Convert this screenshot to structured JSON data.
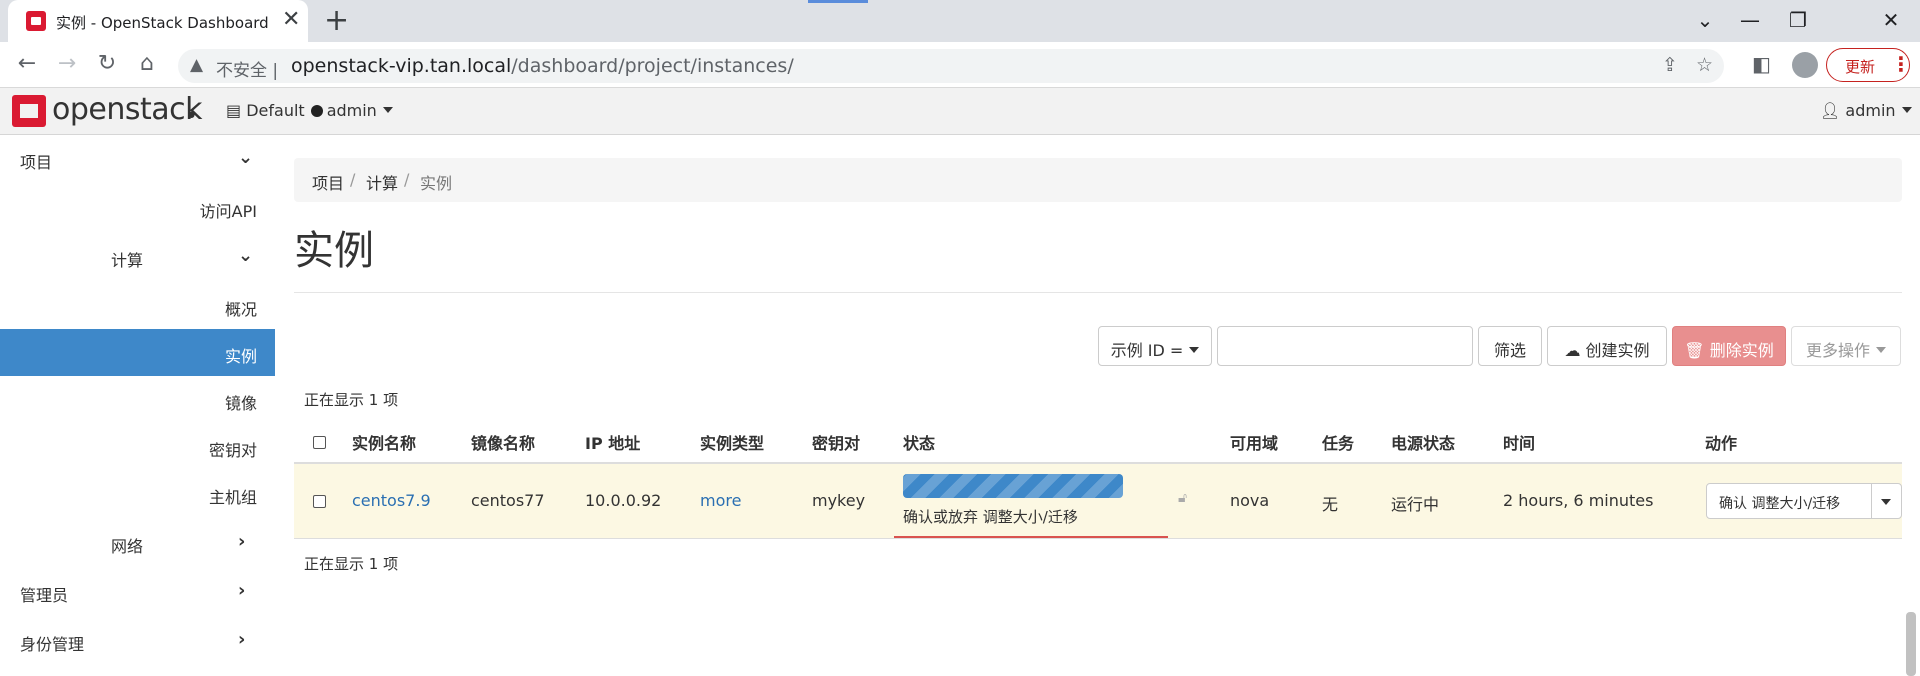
{
  "browser": {
    "tab_title": "实例 - OpenStack Dashboard",
    "tab_close": "✕",
    "new_tab": "+",
    "insecure_label": "不安全",
    "url_host": "openstack-vip.tan.local",
    "url_path": "/dashboard/project/instances/",
    "update_label": "更新",
    "icons": [
      "back-icon",
      "forward-icon",
      "reload-icon",
      "home-icon",
      "warning-icon",
      "share-icon",
      "star-icon",
      "sidepanel-icon",
      "profile-icon",
      "menu-dots-icon"
    ]
  },
  "header": {
    "logo_text": "openstack",
    "domain": "Default",
    "project": "admin",
    "user": "admin"
  },
  "sidebar": {
    "items": [
      {
        "label": "项目",
        "chevron": "down"
      },
      {
        "label": "访问API"
      },
      {
        "label": "计算",
        "chevron": "down"
      },
      {
        "label": "概况"
      },
      {
        "label": "实例",
        "active": true
      },
      {
        "label": "镜像"
      },
      {
        "label": "密钥对"
      },
      {
        "label": "主机组"
      },
      {
        "label": "网络",
        "chevron": "right"
      },
      {
        "label": "管理员",
        "chevron": "right"
      },
      {
        "label": "身份管理",
        "chevron": "right"
      }
    ]
  },
  "breadcrumb": [
    "项目",
    "计算",
    "实例"
  ],
  "page_title": "实例",
  "actions": {
    "filter_field": "示例 ID =",
    "filter_button": "筛选",
    "create_button": "创建实例",
    "delete_button": "删除实例",
    "more_button": "更多操作"
  },
  "showing_count": "正在显示 1 项",
  "table": {
    "headers": [
      "实例名称",
      "镜像名称",
      "IP 地址",
      "实例类型",
      "密钥对",
      "状态",
      "可用域",
      "任务",
      "电源状态",
      "时间",
      "动作"
    ],
    "rows": [
      {
        "name": "centos7.9",
        "image": "centos77",
        "ip": "10.0.0.92",
        "flavor": "more",
        "keypair": "mykey",
        "status": "确认或放弃 调整大小/迁移",
        "zone": "nova",
        "task": "无",
        "power": "运行中",
        "time": "2 hours, 6 minutes",
        "action": "确认 调整大小/迁移"
      }
    ]
  },
  "colors": {
    "accent": "#3e88c9",
    "danger": "#e88f8f",
    "brand": "#da1a32",
    "row_highlight": "#fcf8e3"
  }
}
